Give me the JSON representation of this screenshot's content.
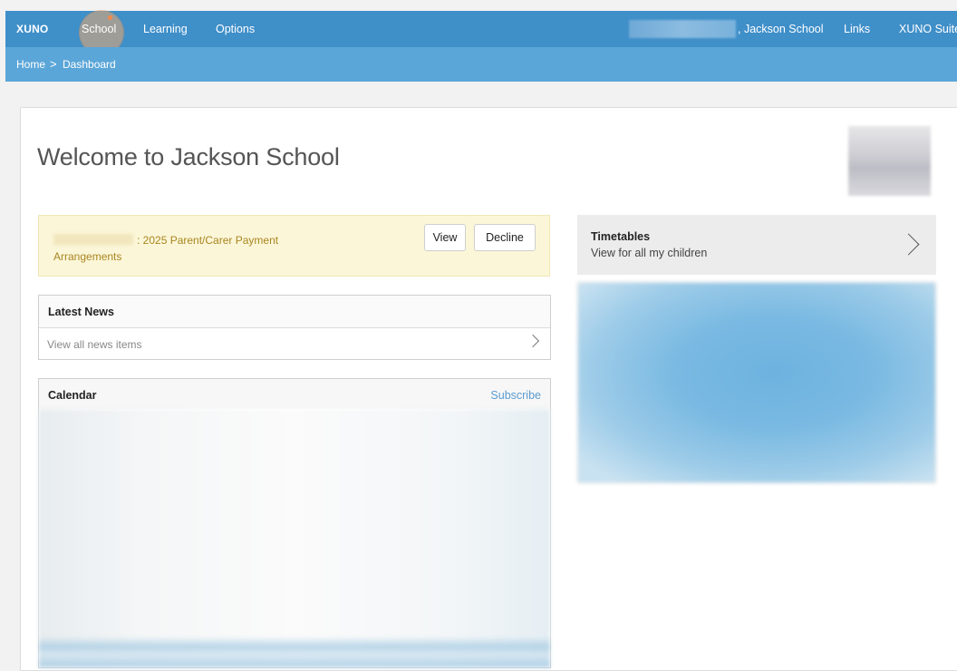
{
  "nav": {
    "brand": "XUNO",
    "items": [
      {
        "label": "School"
      },
      {
        "label": "Learning"
      },
      {
        "label": "Options"
      }
    ],
    "school_name": ", Jackson School",
    "links": "Links",
    "suite": "XUNO Suite"
  },
  "breadcrumb": {
    "home": "Home",
    "separator": ">",
    "current": "Dashboard"
  },
  "welcome": {
    "title": "Welcome to Jackson School"
  },
  "notice": {
    "line1": ": 2025 Parent/Carer Payment",
    "line2": "Arrangements",
    "view_label": "View",
    "decline_label": "Decline"
  },
  "news": {
    "title": "Latest News",
    "link": "View all news items"
  },
  "calendar": {
    "title": "Calendar",
    "subscribe": "Subscribe"
  },
  "timetables": {
    "title": "Timetables",
    "subtitle": "View for all my children"
  },
  "colors": {
    "nav_bg": "#3f8fc9",
    "breadcrumb_bg": "#5ba6d8",
    "notice_bg": "#fbf6d8",
    "notice_text": "#a9861f",
    "link_accent": "#5b9bd0"
  },
  "icons": {
    "news_chevron": "chevron-right-icon",
    "timetables_chevron": "chevron-right-icon"
  }
}
